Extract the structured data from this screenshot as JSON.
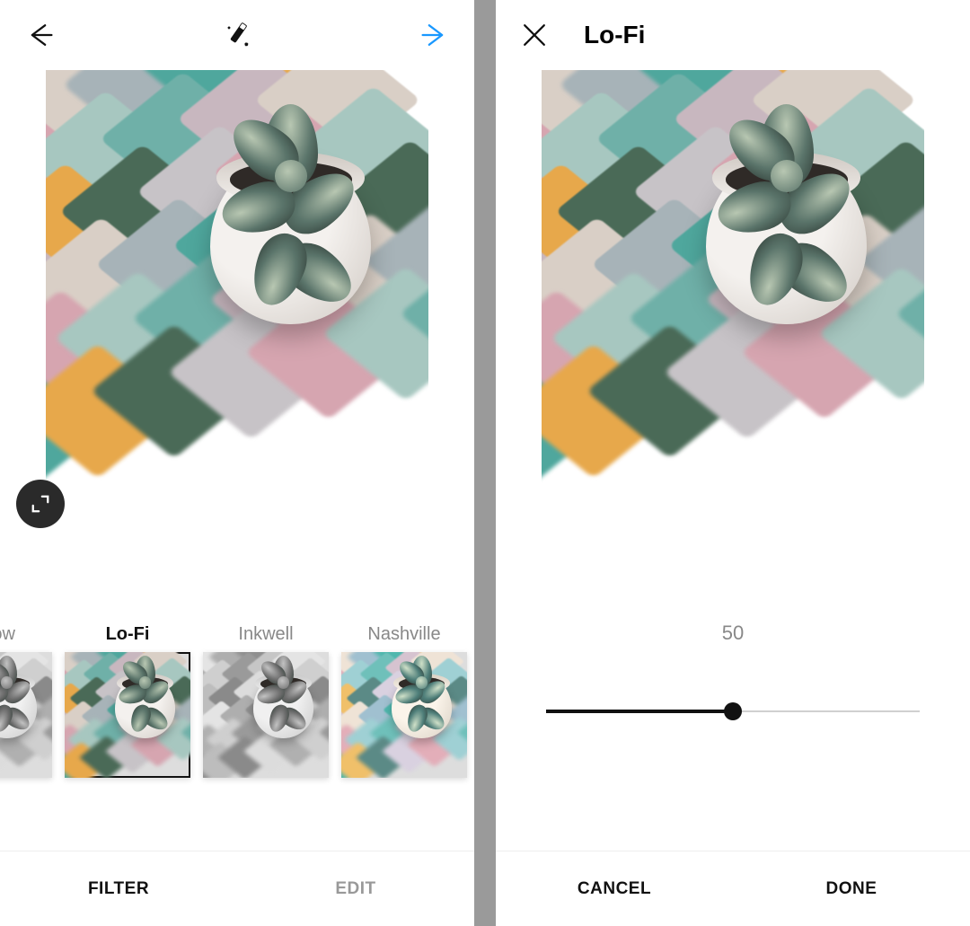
{
  "left": {
    "filters": [
      {
        "name": "Willow",
        "selected": false,
        "style": "bw"
      },
      {
        "name": "Lo-Fi",
        "selected": true,
        "style": "lofi"
      },
      {
        "name": "Inkwell",
        "selected": false,
        "style": "bw"
      },
      {
        "name": "Nashville",
        "selected": false,
        "style": "nash"
      }
    ],
    "tabs": {
      "filter": "FILTER",
      "edit": "EDIT",
      "active": "filter"
    }
  },
  "right": {
    "title": "Lo-Fi",
    "slider": {
      "value": 50,
      "min": 0,
      "max": 100
    },
    "actions": {
      "cancel": "CANCEL",
      "done": "DONE"
    }
  },
  "palette": {
    "lofi": {
      "tiles": [
        "#e7a84b",
        "#4a6a57",
        "#c7c3c7",
        "#d6a5b0",
        "#a7c7c0",
        "#6fb0a8",
        "#c8b7bf",
        "#d9cfc6",
        "#a7b3b8",
        "#4fa79d"
      ],
      "potLight": "#f4f1ee",
      "potShade": "#cfc8c2",
      "leaf": "#5a746a",
      "leafHi": "#b8c7b2"
    },
    "bw": {
      "tiles": [
        "#bdbdbd",
        "#8a8a8a",
        "#dcdcdc",
        "#b0b0b0",
        "#cfcfcf",
        "#9a9a9a",
        "#c6c6c6",
        "#e4e4e4",
        "#aeaeae",
        "#8f8f8f"
      ],
      "potLight": "#f0f0f0",
      "potShade": "#c8c8c8",
      "leaf": "#6f6f6f",
      "leafHi": "#c2c2c2"
    },
    "nash": {
      "tiles": [
        "#f0c06a",
        "#5b8a86",
        "#d9d1e0",
        "#e3aeb9",
        "#9fd0d4",
        "#6fc0ba",
        "#d6c3d0",
        "#efe3d6",
        "#a0c0d0",
        "#4fb7ad"
      ],
      "potLight": "#fbf4ea",
      "potShade": "#d8cfc3",
      "leaf": "#4f7f7a",
      "leafHi": "#cfe0c8"
    }
  }
}
